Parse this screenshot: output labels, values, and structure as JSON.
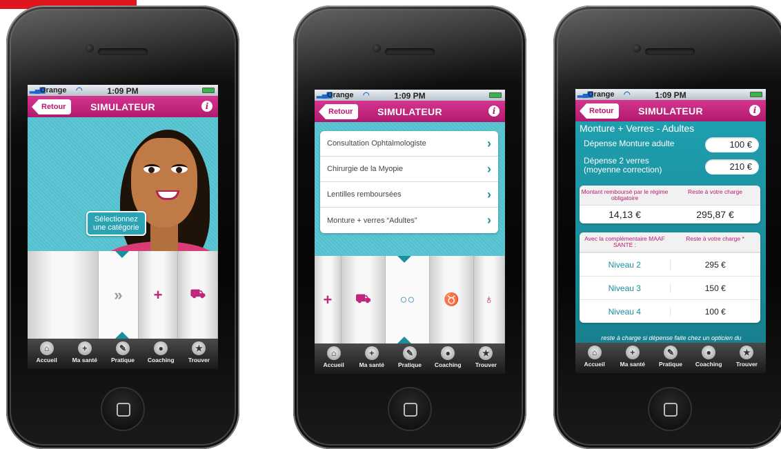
{
  "colors": {
    "accent": "#b8196f",
    "teal": "#1b8ea0",
    "corner_tab": "#e0161f"
  },
  "status": {
    "carrier": "Orange",
    "time": "1:09 PM"
  },
  "navbar": {
    "back_label": "Retour",
    "title": "SIMULATEUR",
    "info_icon": "i"
  },
  "tabbar": [
    {
      "label": "Accueil",
      "icon": "home-icon"
    },
    {
      "label": "Ma santé",
      "icon": "plus-icon"
    },
    {
      "label": "Pratique",
      "icon": "pen-icon"
    },
    {
      "label": "Coaching",
      "icon": "speech-bubble-icon"
    },
    {
      "label": "Trouver",
      "icon": "star-icon"
    }
  ],
  "screen1": {
    "bubble_line1": "Sélectionnez",
    "bubble_line2": "une catégorie",
    "carousel": [
      "",
      "»",
      "+",
      "ambulance"
    ]
  },
  "screen2": {
    "categories": [
      "Consultation Ophtalmologiste",
      "Chirurgie de la Myopie",
      "Lentilles remboursées",
      "Monture + verres “Adultes”"
    ],
    "carousel": [
      "+",
      "ambulance",
      "glasses",
      "tooth",
      "stethoscope"
    ]
  },
  "screen3": {
    "title": "Monture + Verres - Adultes",
    "depense_monture_label": "Dépense Monture adulte",
    "depense_monture_value": "100 €",
    "depense_verres_label_1": "Dépense 2 verres",
    "depense_verres_label_2": "(moyenne correction)",
    "depense_verres_value": "210 €",
    "card1_col1": "Montant remboursé par le régime obligatoire",
    "card1_col2": "Reste à votre charge",
    "card1_val1": "14,13 €",
    "card1_val2": "295,87 €",
    "card2_col1": "Avec la complémentaire MAAF SANTE :",
    "card2_col2": "Reste à votre charge *",
    "levels": [
      {
        "name": "Niveau 2",
        "amount": "295 €"
      },
      {
        "name": "Niveau 3",
        "amount": "150 €"
      },
      {
        "name": "Niveau 4",
        "amount": "100 €"
      }
    ],
    "footnote": "reste à charge si dépense faite chez un opticien du"
  }
}
